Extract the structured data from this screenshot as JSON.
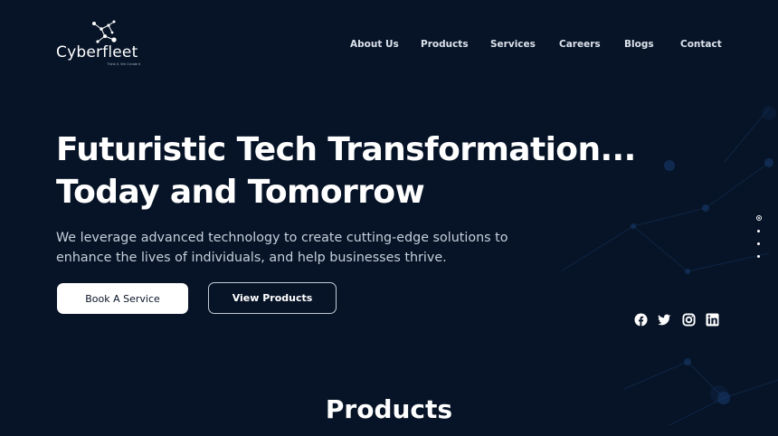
{
  "brand": {
    "name": "Cyberfleet",
    "tagline": "Think it, We Create it"
  },
  "nav": {
    "items": [
      "About Us",
      "Products",
      "Services",
      "Careers",
      "Blogs",
      "Contact"
    ]
  },
  "hero": {
    "title_line1": "Futuristic Tech Transformation...",
    "title_line2": "Today and Tomorrow",
    "subtitle_line1": "We leverage advanced technology to create cutting-edge solutions to",
    "subtitle_line2": "enhance the lives of individuals, and help businesses thrive.",
    "primary_button": "Book A Service",
    "secondary_button": "View Products"
  },
  "carousel": {
    "slide_count": 4,
    "active_index": 0
  },
  "social": {
    "icons": [
      "facebook-icon",
      "twitter-icon",
      "instagram-icon",
      "linkedin-icon"
    ]
  },
  "products": {
    "heading": "Products"
  },
  "colors": {
    "background": "#071427",
    "text": "#ffffff",
    "muted_text": "#c6cfdb",
    "button_bg": "#ffffff",
    "button_text": "#0b1526"
  }
}
